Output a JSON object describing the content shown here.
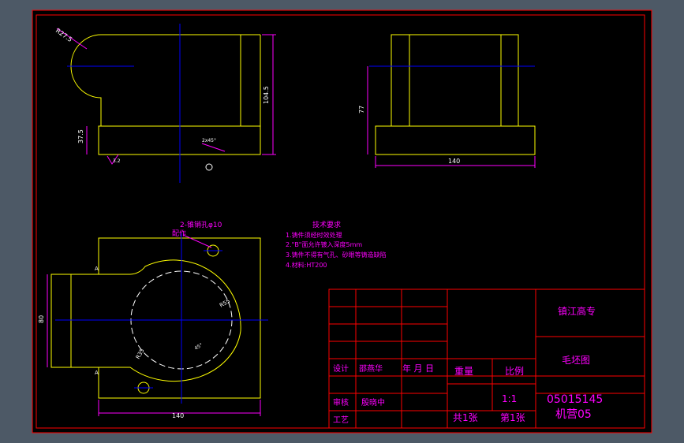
{
  "colors": {
    "window_bg": "#4d5966",
    "canvas_bg": "#000000",
    "frame": "#ff0000",
    "outline": "#ffff00",
    "centerline": "#0000ff",
    "dimension": "#ff00ff",
    "dim_text": "#ffffff",
    "hidden_line": "#ffffff",
    "note_text": "#ff00ff",
    "title_text": "#ff00ff"
  },
  "front_view": {
    "radius_label": "R27.5",
    "height_label": "104.5",
    "base_height_label": "37.5",
    "chamfer_label": "2x45°",
    "roughness_label": "3.2"
  },
  "side_view": {
    "height_label": "77",
    "width_label": "140"
  },
  "top_view": {
    "pin_hole_label": "2-锥销孔φ10",
    "pin_hole_note": "配作",
    "width_label": "140",
    "height_label": "80",
    "radius_label_1": "R55",
    "radius_label_2": "R35",
    "section_mark": "A",
    "chamfer_label": "45°"
  },
  "notes": {
    "title": "技术要求",
    "items": [
      "1.铸件须经时效处理",
      "2.\"B\"面允许镀入深度5mm",
      "3.铸件不得有气孔、砂眼等铸造缺陷",
      "4.材料:HT200"
    ]
  },
  "title_block": {
    "school": "镇江高专",
    "drawing_name": "毛坯图",
    "design_label": "设计",
    "designer": "邵燕华",
    "date_label": "年 月 日",
    "review_label": "审核",
    "reviewer": "殷晓中",
    "process_label": "工艺",
    "weight_label": "重量",
    "scale_label": "比例",
    "scale_value": "1:1",
    "total_sheets": "共1张",
    "sheet_no": "第1张",
    "drawing_code": "05015145",
    "class_code": "机营05"
  }
}
